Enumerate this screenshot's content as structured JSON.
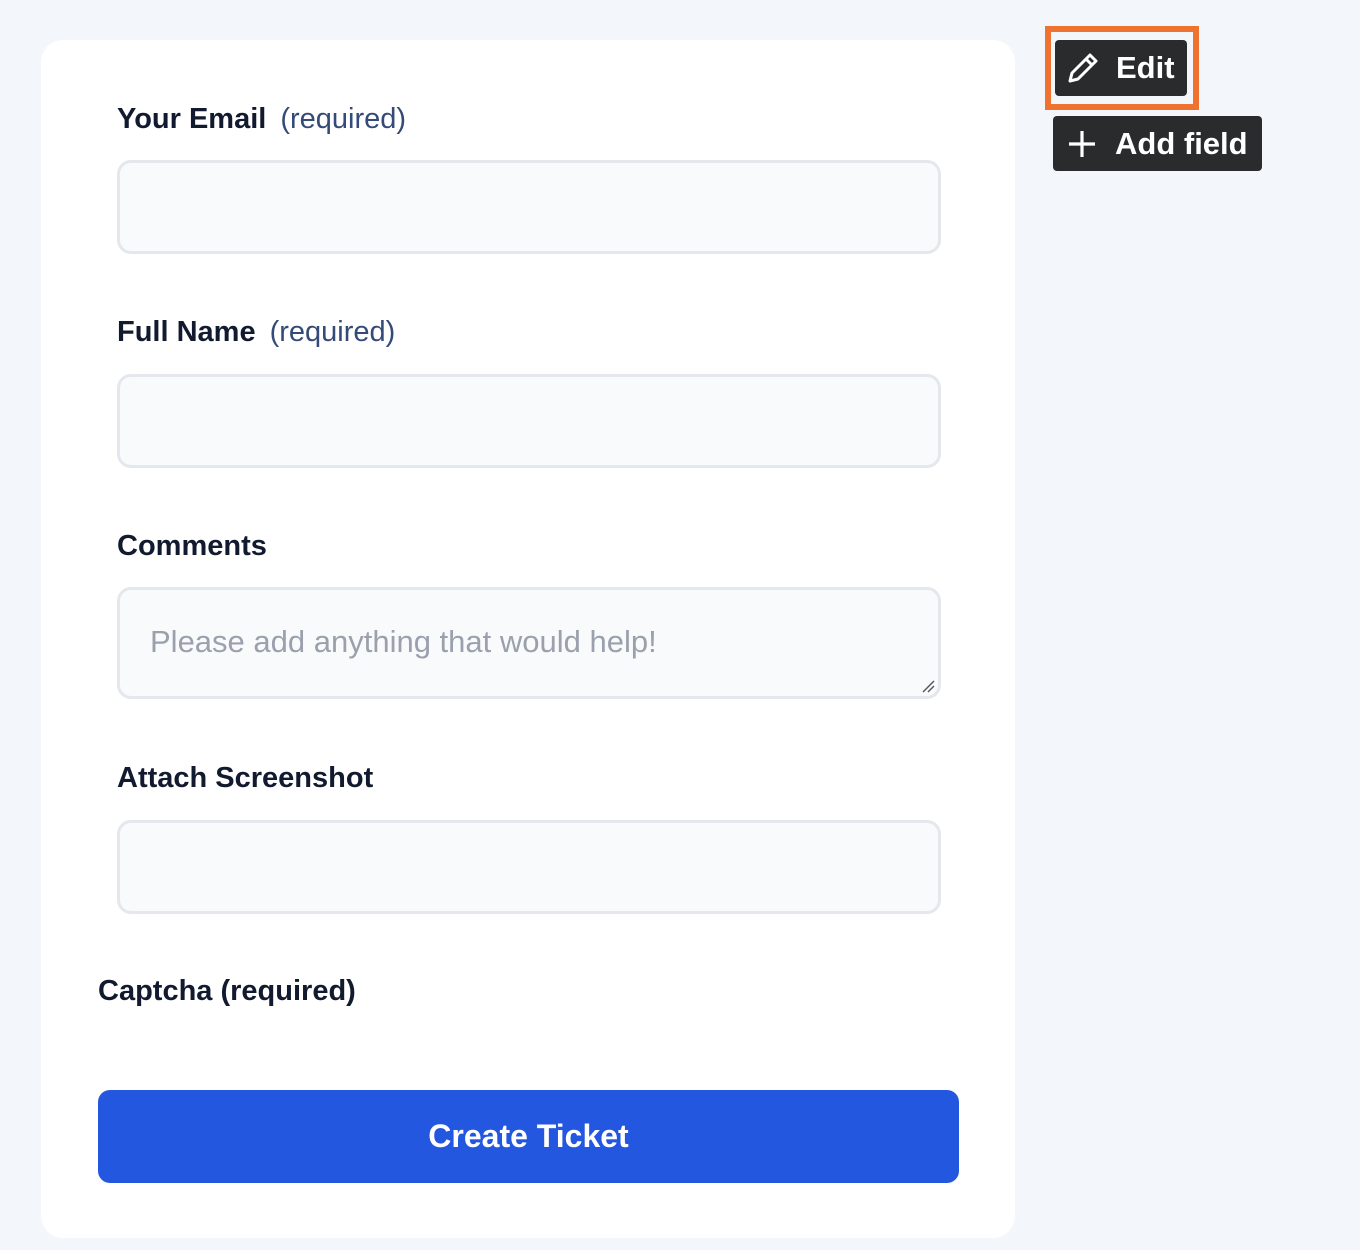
{
  "form": {
    "email": {
      "label": "Your Email",
      "required_text": "(required)",
      "value": ""
    },
    "full_name": {
      "label": "Full Name",
      "required_text": "(required)",
      "value": ""
    },
    "comments": {
      "label": "Comments",
      "placeholder": "Please add anything that would help!"
    },
    "screenshot": {
      "label": "Attach Screenshot"
    },
    "captcha": {
      "label": "Captcha (required)"
    },
    "submit_label": "Create Ticket"
  },
  "toolbar": {
    "edit_label": "Edit",
    "edit_icon": "pencil-icon",
    "add_field_label": "Add field",
    "add_field_icon": "plus-icon",
    "highlight_color": "#ef7230"
  },
  "colors": {
    "primary": "#2457e0",
    "background": "#f3f6fa",
    "toolbar_button": "#2a2b2c"
  }
}
